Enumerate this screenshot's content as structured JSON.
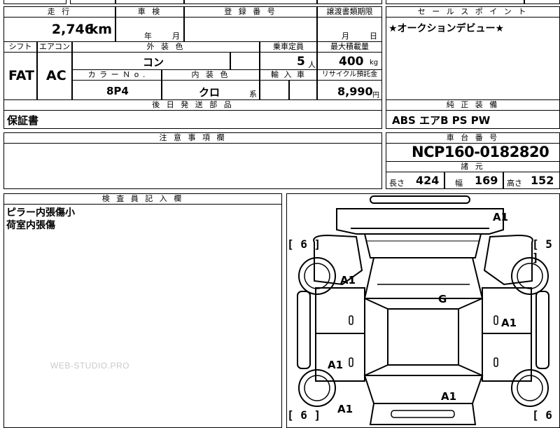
{
  "header_row": {
    "mileage_label": "走 行",
    "shaken_label": "車 検",
    "registration_label": "登 録 番 号",
    "transfer_label": "譲渡書類期限",
    "sales_point_label": "セ ー ル ス ポ イ ン ト"
  },
  "mileage": {
    "value": "2,746",
    "unit": "km"
  },
  "shaken": {
    "year_unit": "年",
    "month_unit": "月"
  },
  "transfer": {
    "month_unit": "月",
    "day_unit": "日"
  },
  "sales_point": {
    "text": "★オークションデビュー★"
  },
  "spec_labels": {
    "shift": "シフト",
    "aircon": "エアコン",
    "exterior_color": "外 装 色",
    "capacity": "乗車定員",
    "max_load": "最大積載量",
    "color_no": "カ ラ ー Ｎ o .",
    "interior_color": "内 装 色",
    "import": "輸 入 車",
    "recycle": "リサイクル預託金"
  },
  "spec_values": {
    "shift": "FAT",
    "aircon": "AC",
    "exterior_color": "コン",
    "capacity": "5",
    "capacity_unit": "人",
    "max_load": "400",
    "max_load_unit": "kg",
    "color_no": "8P4",
    "interior_color": "クロ",
    "interior_suffix": "系",
    "recycle": "8,990",
    "recycle_unit": "円"
  },
  "later_parts": {
    "label": "後 日 発 送 部 品",
    "value": "保証書"
  },
  "equipment": {
    "label": "純 正 装 備",
    "value": "ABS エアB PS PW"
  },
  "notes": {
    "label": "注 意 事 項 欄",
    "value": ""
  },
  "chassis": {
    "label": "車 台 番 号",
    "value": "NCP160-0182820"
  },
  "dimensions": {
    "label": "諸 元",
    "length_label": "長さ",
    "length": "424",
    "width_label": "幅",
    "width": "169",
    "height_label": "高さ",
    "height": "152"
  },
  "inspector": {
    "label": "検 査 員 記 入 欄",
    "lines": [
      "ピラー内張傷小",
      "荷室内張傷"
    ]
  },
  "diagram": {
    "brackets": {
      "tl": "[ 6 ]",
      "tr": "[ 5 ]",
      "bl": "[ 6 ]",
      "br": "[ 6"
    },
    "marks": {
      "front_right": "A1",
      "left_front_wheel": "A1",
      "roof": "G",
      "right_mid": "A1",
      "left_rear_door": "A1",
      "rear_center": "A1",
      "left_rear": "A1"
    }
  },
  "watermark": "WEB-STUDIO.PRO"
}
